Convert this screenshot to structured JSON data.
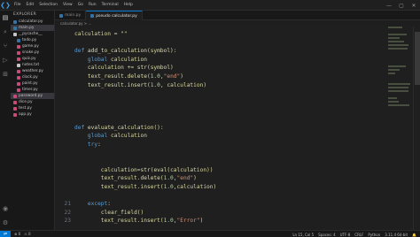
{
  "titlebar": {
    "menu": [
      "File",
      "Edit",
      "Selection",
      "View",
      "Go",
      "Run",
      "Terminal",
      "Help"
    ],
    "controls": [
      "—",
      "▢",
      "✕"
    ]
  },
  "activity_icons": [
    "files-icon",
    "search-icon",
    "source-control-icon",
    "run-debug-icon",
    "extensions-icon"
  ],
  "sidebar": {
    "header": "EXPLORER",
    "items": [
      {
        "label": "calculator.py",
        "color": "#3572a5",
        "selected": false,
        "sub": false
      },
      {
        "label": "main.py",
        "color": "#3572a5",
        "selected": true,
        "sub": false
      },
      {
        "label": "__pycache__",
        "color": "#c5c5c5",
        "selected": false,
        "sub": false
      },
      {
        "label": "todo.py",
        "color": "#3572a5",
        "selected": false,
        "sub": true
      },
      {
        "label": "game.py",
        "color": "#c94b7a",
        "selected": false,
        "sub": true
      },
      {
        "label": "snake.py",
        "color": "#c94b7a",
        "selected": false,
        "sub": true
      },
      {
        "label": "quiz.py",
        "color": "#c94b7a",
        "selected": false,
        "sub": true
      },
      {
        "label": "notes.txt",
        "color": "#c5c5c5",
        "selected": false,
        "sub": true
      },
      {
        "label": "weather.py",
        "color": "#c94b7a",
        "selected": false,
        "sub": true
      },
      {
        "label": "clock.py",
        "color": "#c94b7a",
        "selected": false,
        "sub": true
      },
      {
        "label": "paint.py",
        "color": "#c94b7a",
        "selected": false,
        "sub": true
      },
      {
        "label": "timer.py",
        "color": "#c94b7a",
        "selected": false,
        "sub": true
      },
      {
        "label": "password.py",
        "color": "#c94b7a",
        "selected": true,
        "sub": false
      },
      {
        "label": "dice.py",
        "color": "#c94b7a",
        "selected": false,
        "sub": false
      },
      {
        "label": "test.py",
        "color": "#c94b7a",
        "selected": false,
        "sub": false
      },
      {
        "label": "app.py",
        "color": "#c94b7a",
        "selected": false,
        "sub": false
      }
    ]
  },
  "tabs": [
    {
      "label": "main.py",
      "active": false
    },
    {
      "label": "pseudo calculator.py",
      "active": true
    }
  ],
  "breadcrumb": "calculator.py > ...",
  "code_lines": [
    {
      "n": "",
      "html": "calculation = \"\""
    },
    {
      "n": "",
      "html": ""
    },
    {
      "n": "",
      "html": "<span class='kw'>def</span> <span class='fn'>add_to_calculation</span>(symbol):"
    },
    {
      "n": "",
      "html": "    <span class='kw'>global</span> calculation"
    },
    {
      "n": "",
      "html": "    calculation += <span class='fn'>str</span>(symbol)"
    },
    {
      "n": "",
      "html": "    text_result.<span class='fn'>delete</span>(<span class='num'>1.0</span>,<span class='str'>\"end\"</span>)"
    },
    {
      "n": "",
      "html": "    text_result.<span class='fn'>insert</span>(<span class='num'>1.0</span>, calculation)"
    },
    {
      "n": "",
      "html": ""
    },
    {
      "n": "",
      "html": ""
    },
    {
      "n": "",
      "html": ""
    },
    {
      "n": "",
      "html": ""
    },
    {
      "n": "",
      "html": "<span class='kw'>def</span> <span class='fn'>evaluate_calculation</span>():"
    },
    {
      "n": "",
      "html": "    <span class='kw'>global</span> calculation"
    },
    {
      "n": "",
      "html": "    <span class='kw'>try</span>:"
    },
    {
      "n": "",
      "html": ""
    },
    {
      "n": "",
      "html": ""
    },
    {
      "n": "",
      "html": "        calculation=<span class='fn'>str</span>(<span class='fn'>eval</span>(calculation))"
    },
    {
      "n": "",
      "html": "        text_result.<span class='fn'>delete</span>(<span class='num'>1.0</span>,<span class='str'>\"end\"</span>)"
    },
    {
      "n": "",
      "html": "        text_result.<span class='fn'>insert</span>(<span class='num'>1.0</span>,calculation)"
    },
    {
      "n": "",
      "html": ""
    },
    {
      "n": "21",
      "html": "    <span class='kw'>except</span>:"
    },
    {
      "n": "22",
      "html": "        <span class='fn'>clear_field</span>()"
    },
    {
      "n": "23",
      "html": "        text_result.<span class='fn'>insert</span>(<span class='num'>1.0</span>,<span class='str'>\"Error\"</span>)"
    }
  ],
  "statusbar": {
    "left": [
      "⊗ 0",
      "⚠ 0"
    ],
    "right": [
      "Ln 15, Col 5",
      "Spaces: 4",
      "UTF-8",
      "CRLF",
      "Python",
      "3.11.4 64-bit",
      "🔔"
    ]
  }
}
